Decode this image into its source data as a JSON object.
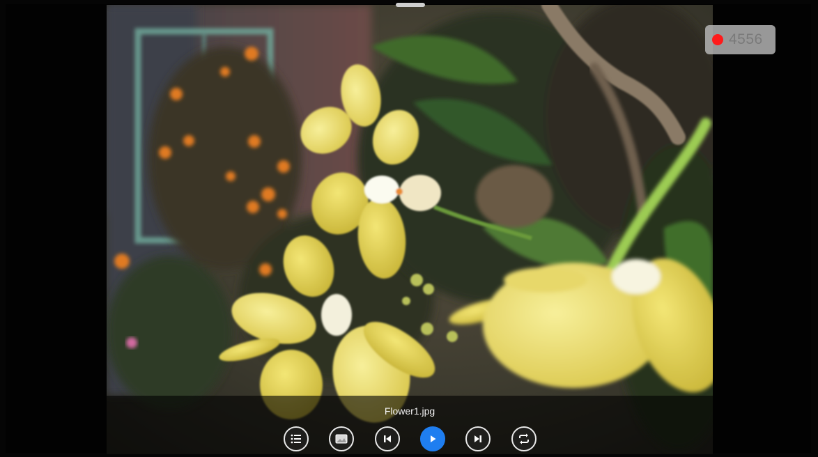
{
  "viewer": {
    "file_name": "Flower1.jpg",
    "photo_description_icon": "photo-image-icon"
  },
  "recording": {
    "count": "4556",
    "dot_color": "#ff1a1a"
  },
  "controls": {
    "items": [
      {
        "name": "playlist-button",
        "icon": "list-icon"
      },
      {
        "name": "slideshow-button",
        "icon": "picture-icon"
      },
      {
        "name": "previous-button",
        "icon": "skip-previous-icon"
      },
      {
        "name": "play-button",
        "icon": "play-icon"
      },
      {
        "name": "next-button",
        "icon": "skip-next-icon"
      },
      {
        "name": "repeat-button",
        "icon": "repeat-icon"
      }
    ],
    "accent_color": "#1f7ef0"
  }
}
